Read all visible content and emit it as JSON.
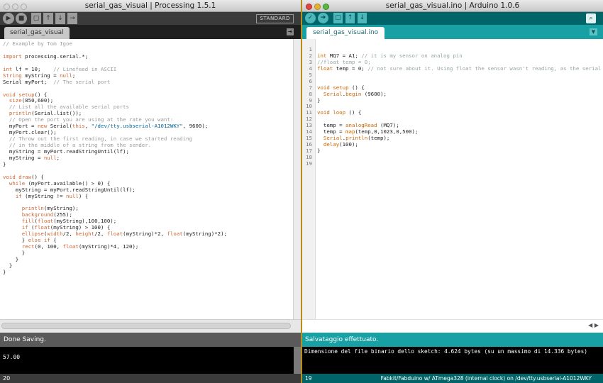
{
  "processing": {
    "window_title": "serial_gas_visual | Processing 1.5.1",
    "mode": "STANDARD",
    "tab": "serial_gas_visual",
    "code_lines": [
      [
        [
          "cm",
          "// Example by Tom Igoe"
        ]
      ],
      [
        [
          "",
          ""
        ]
      ],
      [
        [
          "kw",
          "import"
        ],
        [
          "",
          " processing.serial.*;"
        ]
      ],
      [
        [
          "",
          ""
        ]
      ],
      [
        [
          "kw",
          "int"
        ],
        [
          "",
          " lf = 10;    "
        ],
        [
          "cm",
          "// Linefeed in ASCII"
        ]
      ],
      [
        [
          "cls",
          "String"
        ],
        [
          "",
          " myString = "
        ],
        [
          "kw",
          "null"
        ],
        [
          "",
          ";"
        ]
      ],
      [
        [
          "",
          "Serial myPort;  "
        ],
        [
          "cm",
          "// The serial port"
        ]
      ],
      [
        [
          "",
          ""
        ]
      ],
      [
        [
          "kw",
          "void"
        ],
        [
          "",
          " "
        ],
        [
          "fn",
          "setup"
        ],
        [
          "",
          "() {"
        ]
      ],
      [
        [
          "",
          "  "
        ],
        [
          "fn",
          "size"
        ],
        [
          "",
          "(850,600);"
        ]
      ],
      [
        [
          "",
          "  "
        ],
        [
          "cm",
          "// List all the available serial ports"
        ]
      ],
      [
        [
          "",
          "  "
        ],
        [
          "fn",
          "println"
        ],
        [
          "",
          "(Serial.list());"
        ]
      ],
      [
        [
          "",
          "  "
        ],
        [
          "cm",
          "// Open the port you are using at the rate you want:"
        ]
      ],
      [
        [
          "",
          "  myPort = "
        ],
        [
          "kw",
          "new"
        ],
        [
          "",
          " Serial("
        ],
        [
          "kw",
          "this"
        ],
        [
          "",
          ", "
        ],
        [
          "st",
          "\"/dev/tty.usbserial-A1012WKY\""
        ],
        [
          "",
          ", 9600);"
        ]
      ],
      [
        [
          "",
          "  myPort.clear();"
        ]
      ],
      [
        [
          "",
          "  "
        ],
        [
          "cm",
          "// Throw out the first reading, in case we started reading"
        ]
      ],
      [
        [
          "",
          "  "
        ],
        [
          "cm",
          "// in the middle of a string from the sender."
        ]
      ],
      [
        [
          "",
          "  myString = myPort.readStringUntil(lf);"
        ]
      ],
      [
        [
          "",
          "  myString = "
        ],
        [
          "kw",
          "null"
        ],
        [
          "",
          ";"
        ]
      ],
      [
        [
          "",
          "}"
        ]
      ],
      [
        [
          "",
          ""
        ]
      ],
      [
        [
          "kw",
          "void"
        ],
        [
          "",
          " "
        ],
        [
          "fn",
          "draw"
        ],
        [
          "",
          "() {"
        ]
      ],
      [
        [
          "",
          "  "
        ],
        [
          "kw",
          "while"
        ],
        [
          "",
          " (myPort.available() > 0) {"
        ]
      ],
      [
        [
          "",
          "    myString = myPort.readStringUntil(lf);"
        ]
      ],
      [
        [
          "",
          "    "
        ],
        [
          "kw",
          "if"
        ],
        [
          "",
          " (myString != "
        ],
        [
          "kw",
          "null"
        ],
        [
          "",
          ") {"
        ]
      ],
      [
        [
          "",
          ""
        ]
      ],
      [
        [
          "",
          "      "
        ],
        [
          "fn",
          "println"
        ],
        [
          "",
          "(myString);"
        ]
      ],
      [
        [
          "",
          "      "
        ],
        [
          "fn",
          "background"
        ],
        [
          "",
          "(255);"
        ]
      ],
      [
        [
          "",
          "      "
        ],
        [
          "fn",
          "fill"
        ],
        [
          "",
          "("
        ],
        [
          "kw",
          "float"
        ],
        [
          "",
          "(myString),100,100);"
        ]
      ],
      [
        [
          "",
          "      "
        ],
        [
          "kw",
          "if"
        ],
        [
          "",
          " ("
        ],
        [
          "kw",
          "float"
        ],
        [
          "",
          "(myString) > 100) {"
        ]
      ],
      [
        [
          "",
          "      "
        ],
        [
          "fn",
          "ellipse"
        ],
        [
          "",
          "("
        ],
        [
          "kw",
          "width"
        ],
        [
          "",
          "/2, "
        ],
        [
          "kw",
          "height"
        ],
        [
          "",
          "/2, "
        ],
        [
          "kw",
          "float"
        ],
        [
          "",
          "(myString)*2, "
        ],
        [
          "kw",
          "float"
        ],
        [
          "",
          "(myString)*2);"
        ]
      ],
      [
        [
          "",
          "      } "
        ],
        [
          "kw",
          "else if"
        ],
        [
          "",
          " {"
        ]
      ],
      [
        [
          "",
          "      "
        ],
        [
          "fn",
          "rect"
        ],
        [
          "",
          "(0, 100, "
        ],
        [
          "kw",
          "float"
        ],
        [
          "",
          "(myString)*4, 120);"
        ]
      ],
      [
        [
          "",
          "      }"
        ]
      ],
      [
        [
          "",
          "    }"
        ]
      ],
      [
        [
          "",
          "  }"
        ]
      ],
      [
        [
          "",
          "}"
        ]
      ]
    ],
    "status": "Done Saving.",
    "console_output": "57.00",
    "line_number": "20"
  },
  "arduino": {
    "window_title": "serial_gas_visual.ino | Arduino 1.0.6",
    "tab": "serial_gas_visual.ino",
    "line_numbers": "1\n2\n3\n4\n5\n6\n7\n8\n9\n10\n11\n12\n13\n14\n15\n16\n17\n18\n19",
    "code_lines": [
      [
        [
          "",
          ""
        ]
      ],
      [
        [
          "atype",
          "int"
        ],
        [
          "",
          " MQ7 = A1; "
        ],
        [
          "acm",
          "// it is my sensor on analog pin"
        ]
      ],
      [
        [
          "acm",
          "//float temp = 0;"
        ]
      ],
      [
        [
          "atype",
          "float"
        ],
        [
          "",
          " temp = 0; "
        ],
        [
          "acm",
          "// not sure about it. Using float the sensor wasn't reading, as the serial monitor sho"
        ]
      ],
      [
        [
          "",
          ""
        ]
      ],
      [
        [
          "",
          ""
        ]
      ],
      [
        [
          "atype",
          "void"
        ],
        [
          "",
          " "
        ],
        [
          "akw",
          "setup"
        ],
        [
          "",
          " () {"
        ]
      ],
      [
        [
          "",
          "  "
        ],
        [
          "afn",
          "Serial"
        ],
        [
          "",
          "."
        ],
        [
          "afn",
          "begin"
        ],
        [
          "",
          " (9600);"
        ]
      ],
      [
        [
          "",
          "}"
        ]
      ],
      [
        [
          "",
          ""
        ]
      ],
      [
        [
          "atype",
          "void"
        ],
        [
          "",
          " "
        ],
        [
          "akw",
          "loop"
        ],
        [
          "",
          " () {"
        ]
      ],
      [
        [
          "",
          ""
        ]
      ],
      [
        [
          "",
          "  temp = "
        ],
        [
          "afn",
          "analogRead"
        ],
        [
          "",
          " (MQ7);"
        ]
      ],
      [
        [
          "",
          "  temp = "
        ],
        [
          "afn",
          "map"
        ],
        [
          "",
          "(temp,0,1023,0,500);"
        ]
      ],
      [
        [
          "",
          "  "
        ],
        [
          "afn",
          "Serial"
        ],
        [
          "",
          "."
        ],
        [
          "afn",
          "println"
        ],
        [
          "",
          "(temp);"
        ]
      ],
      [
        [
          "",
          "  "
        ],
        [
          "afn",
          "delay"
        ],
        [
          "",
          "(100);"
        ]
      ],
      [
        [
          "",
          "}"
        ]
      ],
      [
        [
          "",
          ""
        ]
      ],
      [
        [
          "",
          ""
        ]
      ]
    ],
    "status": "Salvataggio effettuato.",
    "console_output": "Dimensione del file binario dello sketch: 4.624 bytes (su un massimo di 14.336 bytes)",
    "line_number": "19",
    "board": "Fabkit/Fabduino w/ ATmega328 (internal clock) on /dev/tty.usbserial-A1012WKY"
  }
}
